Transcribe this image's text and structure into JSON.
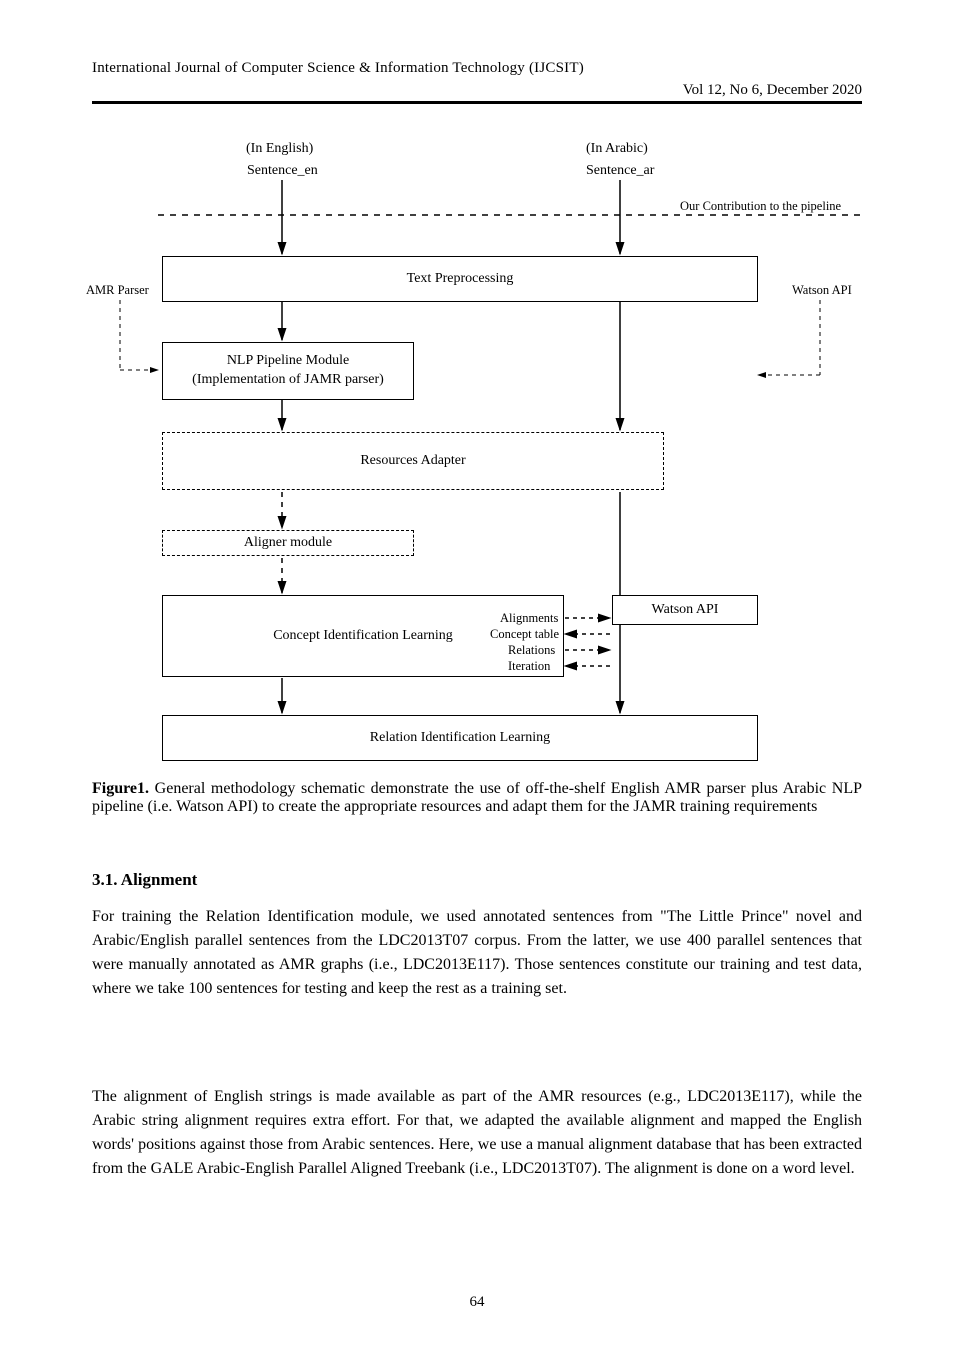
{
  "header": {
    "journal": "International Journal of Computer Science & Information Technology (IJCSIT)",
    "vol_left": "Vol 12, No 6, December 2020",
    "vol_right": "Vol 12, No 6, December 2020"
  },
  "diagram": {
    "top_labels": {
      "en": "(In English)",
      "ar": "(In Arabic)"
    },
    "sentence_en": "Sentence_en",
    "sentence_ar": "Sentence_ar",
    "extern_left": "AMR Parser",
    "extern_right": "Watson API",
    "pipeline_dashed": "Our Contribution to the pipeline",
    "boxes": {
      "preproc": "Text Preprocessing",
      "nlp_main": "NLP Pipeline Module\n(Implementation of JAMR parser)",
      "nlp_side": "Watson API",
      "adapter": "Resources Adapter",
      "aligner": "Aligner module",
      "clearn_left": "Concept Identification Learning",
      "clearn_right": "Watson API",
      "interact1": "Alignments",
      "interact2": "Concept table",
      "interact3": "Relations",
      "interact4": "Iteration",
      "final": "Relation Identification Learning"
    }
  },
  "figure_caption": {
    "label": "Figure1.",
    "text": "General methodology schematic demonstrate the use of off-the-shelf English AMR parser plus Arabic NLP pipeline (i.e. Watson API) to create the appropriate resources and adapt them for the JAMR training requirements"
  },
  "section_title": "3.1. Alignment",
  "body1": "For training the Relation Identification module, we used annotated sentences from \"The Little Prince\" novel and Arabic/English parallel sentences from the LDC2013T07 corpus. From the latter, we use 400 parallel sentences that were manually annotated as AMR graphs (i.e., LDC2013E117). Those sentences constitute our training and test data, where we take 100 sentences for testing and keep the rest as a training set.",
  "body2": "The alignment of English strings is made available as part of the AMR resources (e.g., LDC2013E117), while the Arabic string alignment requires extra effort. For that, we adapted the available alignment and mapped the English words' positions against those from Arabic sentences. Here, we use a manual alignment database that has been extracted from the GALE Arabic-English Parallel Aligned Treebank (i.e., LDC2013T07). The alignment is done on a word level.",
  "page_num": "64"
}
